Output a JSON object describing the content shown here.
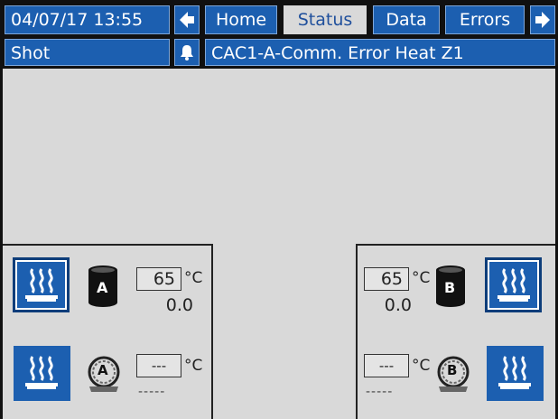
{
  "header": {
    "datetime": "04/07/17 13:55",
    "tabs": [
      {
        "label": "Home",
        "active": false
      },
      {
        "label": "Status",
        "active": true
      },
      {
        "label": "Data",
        "active": false
      },
      {
        "label": "Errors",
        "active": false
      }
    ],
    "mode": "Shot",
    "alarm_message": "CAC1-A-Comm. Error Heat Z1"
  },
  "left_panel": {
    "tank_label": "A",
    "tank_temp_setpoint": "65",
    "tank_temp_unit": "°C",
    "tank_temp_actual": "0.0",
    "hose_label": "A",
    "hose_temp_setpoint": "---",
    "hose_temp_unit": "°C",
    "hose_temp_actual": "-----"
  },
  "right_panel": {
    "tank_label": "B",
    "tank_temp_setpoint": "65",
    "tank_temp_unit": "°C",
    "tank_temp_actual": "0.0",
    "hose_label": "B",
    "hose_temp_setpoint": "---",
    "hose_temp_unit": "°C",
    "hose_temp_actual": "-----"
  },
  "icons": {
    "left_arrow": "arrow-left-icon",
    "right_arrow": "arrow-right-icon",
    "alarm": "alarm-bell-icon",
    "heat": "heat-wave-icon",
    "tank": "tank-icon",
    "hose": "hose-reel-icon"
  },
  "colors": {
    "accent_blue": "#1c5fb0",
    "background": "#d9d9d9",
    "text_dark": "#222222"
  }
}
